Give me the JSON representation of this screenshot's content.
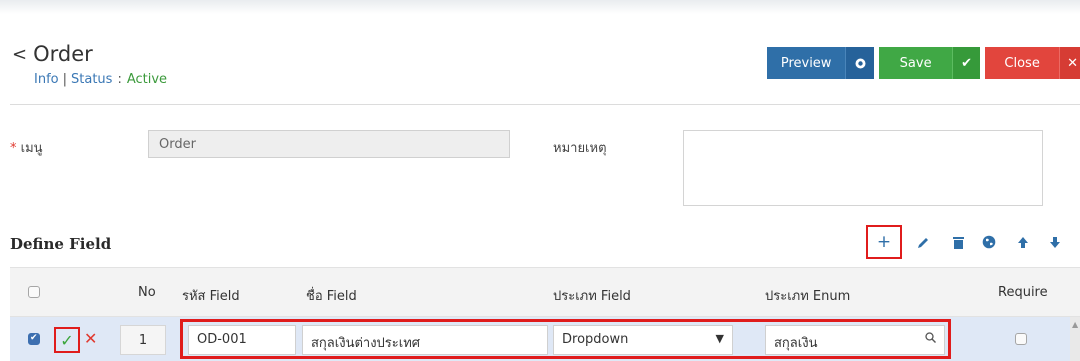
{
  "header": {
    "back_icon": "chevron-left-icon",
    "title": "Order",
    "info_label": "Info",
    "separator": "|",
    "status_label": "Status",
    "status_colon": ":",
    "status_value": "Active"
  },
  "actions": {
    "preview_label": "Preview",
    "save_label": "Save",
    "close_label": "Close",
    "colors": {
      "preview": "#2f6fa8",
      "save": "#40a845",
      "close": "#e2453d"
    }
  },
  "form": {
    "menu_label": "เมนู",
    "menu_value": "Order",
    "remark_label": "หมายเหตุ",
    "remark_value": ""
  },
  "define_field": {
    "title": "Define Field",
    "toolbar_icons": [
      "plus-icon",
      "pencil-icon",
      "trash-icon",
      "globe-icon",
      "arrow-up-icon",
      "arrow-down-icon"
    ]
  },
  "table": {
    "columns": {
      "no": "No",
      "field_code": "รหัส Field",
      "field_name": "ชื่อ Field",
      "field_type": "ประเภท Field",
      "enum_type": "ประเภท Enum",
      "require": "Require"
    },
    "row": {
      "no": "1",
      "field_code": "OD-001",
      "field_name": "สกุลเงินต่างประเทศ",
      "field_type": "Dropdown",
      "enum_type": "สกุลเงิน",
      "selected": true,
      "require": false
    }
  }
}
